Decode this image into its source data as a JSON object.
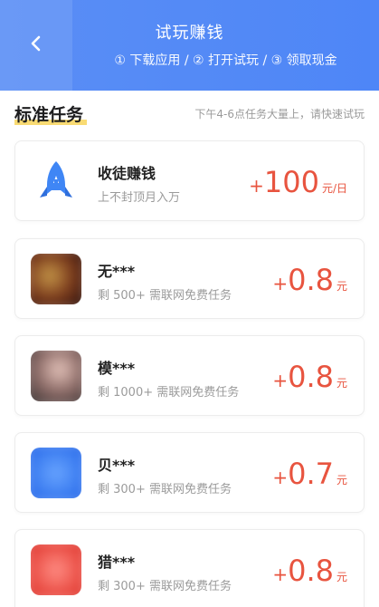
{
  "header": {
    "title": "试玩赚钱",
    "steps": "① 下载应用 / ② 打开试玩 / ③ 领取现金"
  },
  "section": {
    "title": "标准任务",
    "hint": "下午4-6点任务大量上，请快速试玩"
  },
  "featured": {
    "name": "收徒赚钱",
    "desc": "上不封顶月入万",
    "plus": "+",
    "amount": "100",
    "unit": "元/日"
  },
  "tasks": [
    {
      "name": "无***",
      "desc": "剩 500+ 需联网免费任务",
      "plus": "+",
      "amount": "0.8",
      "unit": "元"
    },
    {
      "name": "模***",
      "desc": "剩 1000+ 需联网免费任务",
      "plus": "+",
      "amount": "0.8",
      "unit": "元"
    },
    {
      "name": "贝***",
      "desc": "剩 300+ 需联网免费任务",
      "plus": "+",
      "amount": "0.7",
      "unit": "元"
    },
    {
      "name": "猎***",
      "desc": "剩 300+ 需联网免费任务",
      "plus": "+",
      "amount": "0.8",
      "unit": "元"
    }
  ],
  "colors": {
    "header": "#4e86f7",
    "reward": "#e8543f",
    "underline": "#f8d55b"
  },
  "icons": {
    "back": "chevron-left-icon",
    "featured": "rocket-icon"
  }
}
